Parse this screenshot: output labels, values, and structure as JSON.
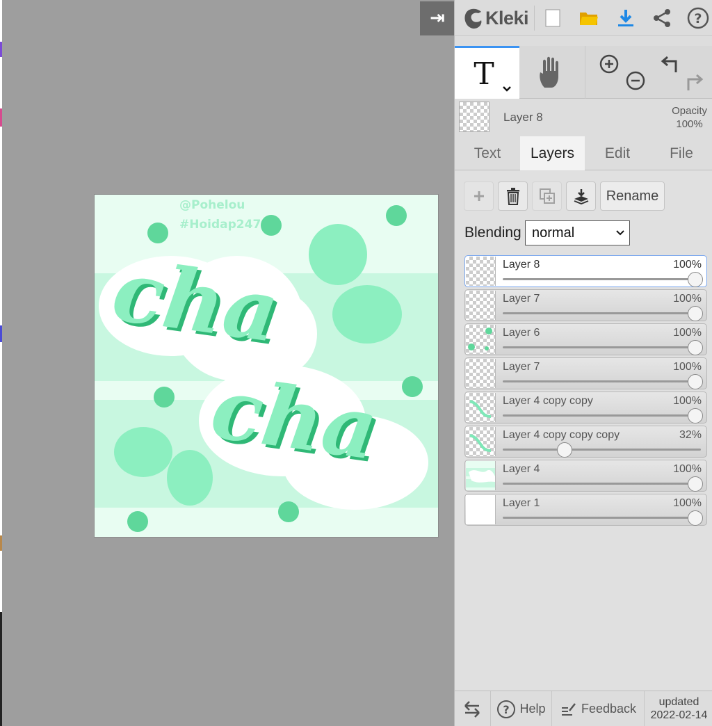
{
  "app": {
    "name": "Kleki",
    "updated_label": "updated",
    "updated_date": "2022-02-14"
  },
  "toolbar": {
    "icons": [
      "new-image-icon",
      "open-folder-icon",
      "download-icon",
      "share-icon",
      "help-icon"
    ],
    "accent": "#1e88e5",
    "folder_color": "#f5b800"
  },
  "tools": {
    "active": "text-tool",
    "items": [
      "text-tool",
      "hand-tool",
      "zoom-in",
      "zoom-out",
      "undo",
      "redo"
    ]
  },
  "current_layer": {
    "name": "Layer 8",
    "opacity_label": "Opacity",
    "opacity_value": "100%"
  },
  "tabs": [
    {
      "label": "Text"
    },
    {
      "label": "Layers"
    },
    {
      "label": "Edit"
    },
    {
      "label": "File"
    }
  ],
  "active_tab": "Layers",
  "layer_actions": {
    "rename_label": "Rename"
  },
  "blending": {
    "label": "Blending",
    "value": "normal"
  },
  "layers": [
    {
      "name": "Layer 8",
      "opacity": "100%",
      "value": 1.0,
      "selected": true
    },
    {
      "name": "Layer 7",
      "opacity": "100%",
      "value": 1.0
    },
    {
      "name": "Layer 6",
      "opacity": "100%",
      "value": 1.0
    },
    {
      "name": "Layer 7",
      "opacity": "100%",
      "value": 1.0
    },
    {
      "name": "Layer 4 copy copy",
      "opacity": "100%",
      "value": 1.0
    },
    {
      "name": "Layer 4 copy copy copy",
      "opacity": "32%",
      "value": 0.32
    },
    {
      "name": "Layer 4",
      "opacity": "100%",
      "value": 1.0
    },
    {
      "name": "Layer 1",
      "opacity": "100%",
      "value": 1.0
    }
  ],
  "footer": {
    "help_label": "Help",
    "feedback_label": "Feedback"
  },
  "artwork": {
    "watermark_line1": "@Pohelou",
    "watermark_line2": "#Hoidap247",
    "text_line1": "cha",
    "text_line2": "cha",
    "colors": {
      "background": "#e8fdf2",
      "stripe": "#c8f7e0",
      "dot": "#5fd79b",
      "blob": "#8cefc0",
      "letter": "#7fe8b8",
      "letter_dark": "#2fb876",
      "outline": "#ffffff"
    }
  }
}
